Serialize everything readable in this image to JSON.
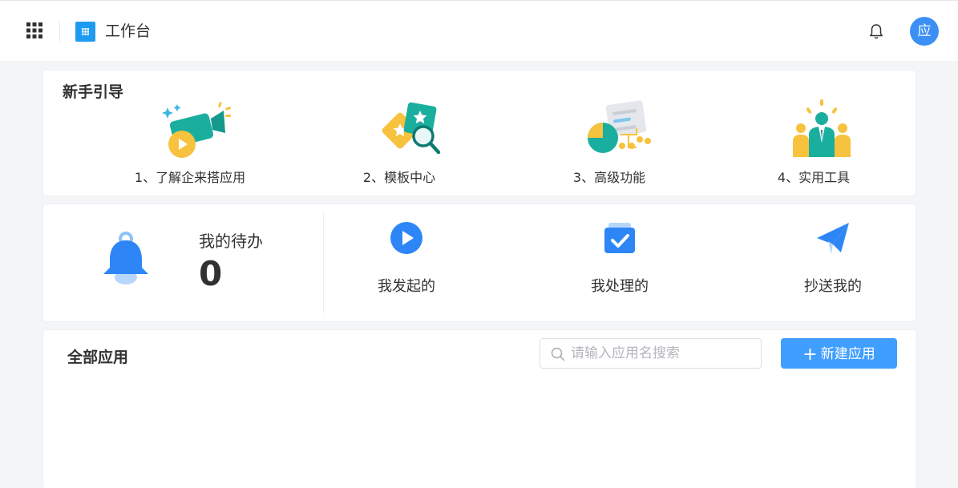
{
  "header": {
    "title": "工作台",
    "avatar_text": "应"
  },
  "guide": {
    "title": "新手引导",
    "items": [
      {
        "label": "1、了解企来搭应用",
        "icon": "video-camera-icon"
      },
      {
        "label": "2、模板中心",
        "icon": "template-cards-icon"
      },
      {
        "label": "3、高级功能",
        "icon": "advanced-chart-icon"
      },
      {
        "label": "4、实用工具",
        "icon": "team-people-icon"
      }
    ]
  },
  "todo": {
    "label": "我的待办",
    "count": "0",
    "quick_links": [
      {
        "label": "我发起的",
        "icon": "play-circle-icon"
      },
      {
        "label": "我处理的",
        "icon": "checked-box-icon"
      },
      {
        "label": "抄送我的",
        "icon": "paper-plane-icon"
      }
    ]
  },
  "apps": {
    "title": "全部应用",
    "search_placeholder": "请输入应用名搜索",
    "new_button": "新建应用"
  },
  "colors": {
    "primary": "#409eff",
    "logo": "#1e9bf0",
    "bell": "#2e86f6",
    "teal": "#1aae9f",
    "yellow": "#f7c23d"
  }
}
